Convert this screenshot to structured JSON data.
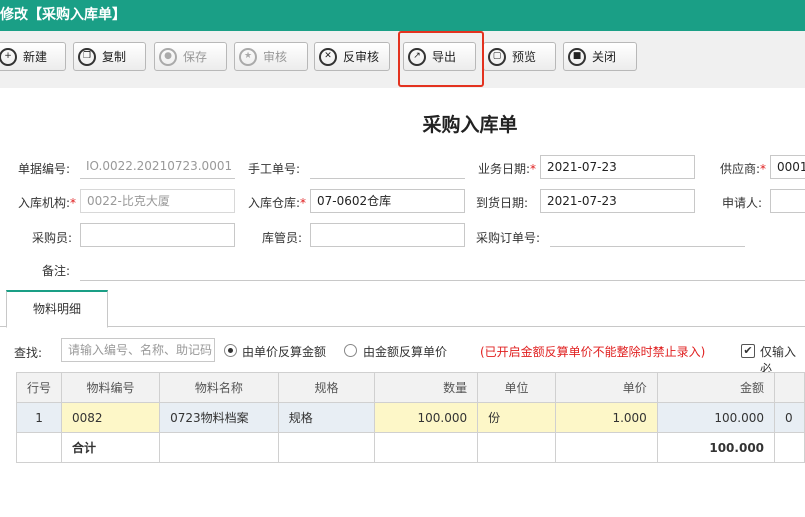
{
  "window": {
    "title": "修改【采购入库单】"
  },
  "toolbar": {
    "new": "新建",
    "copy": "复制",
    "save": "保存",
    "audit": "审核",
    "unaudit": "反审核",
    "export": "导出",
    "preview": "预览",
    "close": "关闭"
  },
  "form": {
    "title": "采购入库单",
    "doc_no": {
      "label": "单据编号:",
      "value": "IO.0022.20210723.0001"
    },
    "manual_no": {
      "label": "手工单号:",
      "value": ""
    },
    "biz_date": {
      "label": "业务日期:",
      "value": "2021-07-23"
    },
    "supplier": {
      "label": "供应商:",
      "value": "0001-"
    },
    "org": {
      "label": "入库机构:",
      "value": "0022-比克大厦"
    },
    "warehouse": {
      "label": "入库仓库:",
      "value": "07-0602仓库"
    },
    "arrival_date": {
      "label": "到货日期:",
      "value": "2021-07-23"
    },
    "applicant": {
      "label": "申请人:",
      "value": ""
    },
    "purchaser": {
      "label": "采购员:",
      "value": ""
    },
    "keeper": {
      "label": "库管员:",
      "value": ""
    },
    "po_no": {
      "label": "采购订单号:",
      "value": ""
    },
    "remark": {
      "label": "备注:",
      "value": ""
    },
    "required_mark": "*"
  },
  "tabs": [
    {
      "label": "物料明细"
    }
  ],
  "detail": {
    "search_label": "查找:",
    "search_placeholder": "请输入编号、名称、助记码",
    "radio_by_price": "由单价反算金额",
    "radio_by_amount": "由金额反算单价",
    "warning": "(已开启金额反算单价不能整除时禁止录入)",
    "only_input_label": "仅输入必",
    "checkmark": "✔"
  },
  "table": {
    "headers": [
      "行号",
      "物料编号",
      "物料名称",
      "规格",
      "数量",
      "单位",
      "单价",
      "金额",
      ""
    ],
    "rows": [
      [
        "1",
        "0082",
        "0723物料档案",
        "规格",
        "100.000",
        "份",
        "1.000",
        "100.000",
        "0"
      ]
    ],
    "total": {
      "label": "合计",
      "amount": "100.000"
    }
  }
}
